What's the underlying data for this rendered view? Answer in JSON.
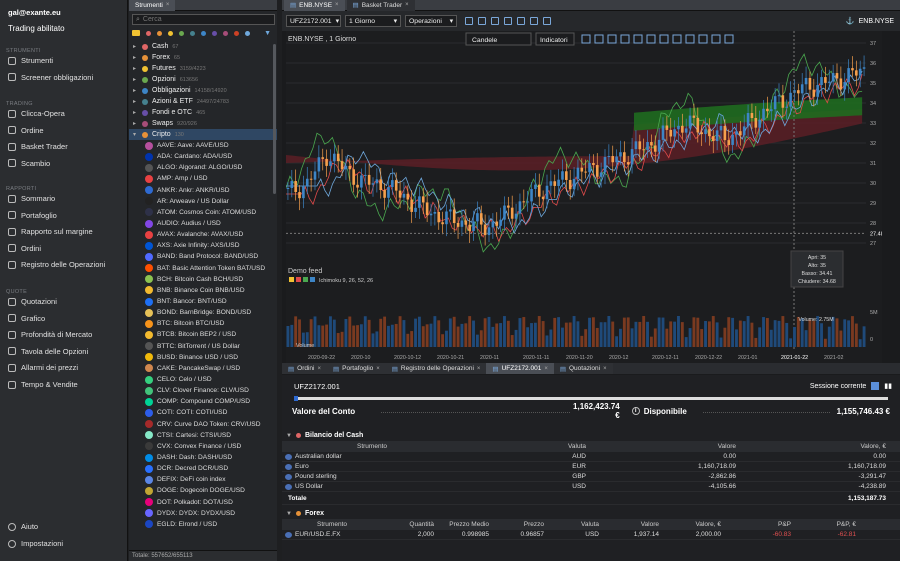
{
  "nav": {
    "user": "gal@exante.eu",
    "trading": "Trading abilitato",
    "sections": [
      {
        "title": "STRUMENTI",
        "items": [
          "Strumenti",
          "Screener obbligazioni"
        ]
      },
      {
        "title": "TRADING",
        "items": [
          "Clicca-Opera",
          "Ordine",
          "Basket Trader",
          "Scambio"
        ]
      },
      {
        "title": "RAPPORTI",
        "items": [
          "Sommario",
          "Portafoglio",
          "Rapporto sul margine",
          "Ordini",
          "Registro delle Operazioni"
        ]
      },
      {
        "title": "QUOTE",
        "items": [
          "Quotazioni",
          "Grafico",
          "Profondità di Mercato",
          "Tavola delle Opzioni",
          "Allarmi dei prezzi",
          "Tempo & Vendite"
        ]
      }
    ],
    "bottom": [
      "Aiuto",
      "Impostazioni"
    ]
  },
  "tree": {
    "tab": "Strumenti",
    "search_placeholder": "Cerca",
    "filter_colors": [
      "#e06666",
      "#e69138",
      "#f1c232",
      "#6aa84f",
      "#45818e",
      "#3d85c6",
      "#674ea7",
      "#a64d79",
      "#cc4125",
      "#6fa8dc"
    ],
    "categories": [
      {
        "label": "Cash",
        "count": "67",
        "color": "#e06666"
      },
      {
        "label": "Forex",
        "count": "65",
        "color": "#e69138"
      },
      {
        "label": "Futures",
        "count": "3159/4223",
        "color": "#f1c232"
      },
      {
        "label": "Opzioni",
        "count": "613656",
        "color": "#6aa84f"
      },
      {
        "label": "Obbligazioni",
        "count": "14158/14920",
        "color": "#3d85c6"
      },
      {
        "label": "Azioni & ETF",
        "count": "24497/24783",
        "color": "#45818e"
      },
      {
        "label": "Fondi e OTC",
        "count": "465",
        "color": "#674ea7"
      },
      {
        "label": "Swaps",
        "count": "920/926",
        "color": "#a64d79"
      },
      {
        "label": "Cripto",
        "count": "130",
        "color": "#e69138"
      }
    ],
    "coins": [
      "AAVE: Aave: AAVE/USD",
      "ADA: Cardano: ADA/USD",
      "ALGO: Algorand: ALGO/USD",
      "AMP: Amp / USD",
      "ANKR: Ankr: ANKR/USD",
      "AR: Arweave / US Dollar",
      "ATOM: Cosmos Coin: ATOM/USD",
      "AUDIO: Audius / USD",
      "AVAX: Avalanche: AVAX/USD",
      "AXS: Axie Infinity: AXS/USD",
      "BAND: Band Protocol: BAND/USD",
      "BAT: Basic Attention Token BAT/USD",
      "BCH: Bitcoin Cash BCH/USD",
      "BNB: Binance Coin BNB/USD",
      "BNT: Bancor: BNT/USD",
      "BOND: BarnBridge: BOND/USD",
      "BTC: Bitcoin BTC/USD",
      "BTCB: Bitcoin BEP2 / USD",
      "BTTC: BitTorrent / US Dollar",
      "BUSD: Binance USD / USD",
      "CAKE: PancakeSwap / USD",
      "CELO: Celo / USD",
      "CLV: Clover Finance: CLV/USD",
      "COMP: Compound COMP/USD",
      "COTI: COTI: COTI/USD",
      "CRV: Curve DAO Token: CRV/USD",
      "CTSI: Cartesi: CTSI/USD",
      "CVX: Convex Finance / USD",
      "DASH: Dash: DASH/USD",
      "DCR: Decred DCR/USD",
      "DEFIX: DeFi coin index",
      "DOGE: Dogecoin DOGE/USD",
      "DOT: Polkadot: DOT/USD",
      "DYDX: DYDX: DYDX/USD",
      "EGLD: Elrond / USD"
    ],
    "coin_colors": [
      "#b6509e",
      "#0033ad",
      "#555",
      "#e84142",
      "#2e6ad1",
      "#222",
      "#2e3148",
      "#8247e5",
      "#e84142",
      "#0055d5",
      "#516aff",
      "#ff5000",
      "#8dc351",
      "#f3ba2f",
      "#1e6ff3",
      "#e6c158",
      "#f7931a",
      "#f3ba2f",
      "#555",
      "#f0b90b",
      "#d1884f",
      "#35d07f",
      "#42c37b",
      "#00d395",
      "#2d5dea",
      "#a52a2a",
      "#86e8c7",
      "#3a3a3a",
      "#008ce7",
      "#2970ff",
      "#5b86e5",
      "#c2a633",
      "#e6007a",
      "#6966ff",
      "#1b46c2"
    ],
    "footer": "Totale: 557652/655113"
  },
  "chart": {
    "tabs": [
      "ENB.NYSE",
      "Basket Trader"
    ],
    "symbol": "UFZ2172.001",
    "interval": "1 Giorno",
    "operations": "Operazioni",
    "ticker_right": "ENB.NYSE",
    "title": "ENB.NYSE , 1 Giorno",
    "style": "Candele",
    "indicators": "Indicatori",
    "demo": "Demo feed",
    "ichimoku": "Ichimoku 9, 26, 52, 26",
    "volume_label": "Volume",
    "price_labels": [
      "37",
      "36",
      "35",
      "34",
      "33",
      "32",
      "31",
      "30",
      "29",
      "28",
      "27.48",
      "27"
    ],
    "vol_labels": [
      "5M",
      "0"
    ],
    "x_labels": [
      "2020-09-22",
      "2020-10",
      "2020-10-12",
      "2020-10-21",
      "2020-11",
      "2020-11-11",
      "2020-11-20",
      "2020-12",
      "2020-12-11",
      "2020-12-22",
      "2021-01",
      "2021-01-22",
      "2021-02"
    ],
    "ohlc": {
      "open": "Apri: 35",
      "high": "Alto: 35",
      "low": "Basso: 34.41",
      "close": "Chiudere: 34.68",
      "volume": "Volume: 2.75M"
    }
  },
  "chart_data": {
    "type": "candlestick",
    "ylim": [
      26.5,
      37.3
    ],
    "x": [
      "2020-09-22",
      "2020-10",
      "2020-10-12",
      "2020-10-21",
      "2020-11",
      "2020-11-11",
      "2020-11-20",
      "2020-12",
      "2020-12-11",
      "2020-12-22",
      "2021-01",
      "2021-01-22",
      "2021-02"
    ],
    "last_price": 27.48,
    "selected": {
      "open": 35,
      "high": 35,
      "low": 34.41,
      "close": 34.68,
      "volume": "2.75M"
    }
  },
  "bottom": {
    "tabs": [
      "Ordini",
      "Portafoglio",
      "Registro delle Operazioni",
      "UFZ2172.001",
      "Quotazioni"
    ],
    "account": "UFZ2172.001",
    "session": "Sessione corrente",
    "acct_value_label": "Valore del Conto",
    "acct_value": "1,162,423.74 €",
    "avail_label": "Disponibile",
    "avail": "1,155,746.43 €",
    "cash_title": "Bilancio del Cash",
    "cash_headers": [
      "Strumento",
      "Valuta",
      "Valore",
      "Valore, €"
    ],
    "cash_rows": [
      [
        "Australian dollar",
        "AUD",
        "0.00",
        "0.00"
      ],
      [
        "Euro",
        "EUR",
        "1,160,718.09",
        "1,160,718.09"
      ],
      [
        "Pound sterling",
        "GBP",
        "-2,862.86",
        "-3,291.47"
      ],
      [
        "US Dollar",
        "USD",
        "-4,105.66",
        "-4,238.89"
      ]
    ],
    "total_label": "Totale",
    "total": "1,153,187.73",
    "forex_title": "Forex",
    "forex_headers": [
      "Strumento",
      "Quantità",
      "Prezzo Medio",
      "Prezzo",
      "Valuta",
      "Valore",
      "Valore, €",
      "P&P",
      "P&P, €"
    ],
    "forex_rows": [
      [
        "EUR/USD.E.FX",
        "2,000",
        "0.998985",
        "0.96857",
        "USD",
        "1,937.14",
        "2,000.00",
        "-60.83",
        "-62.81"
      ]
    ]
  }
}
